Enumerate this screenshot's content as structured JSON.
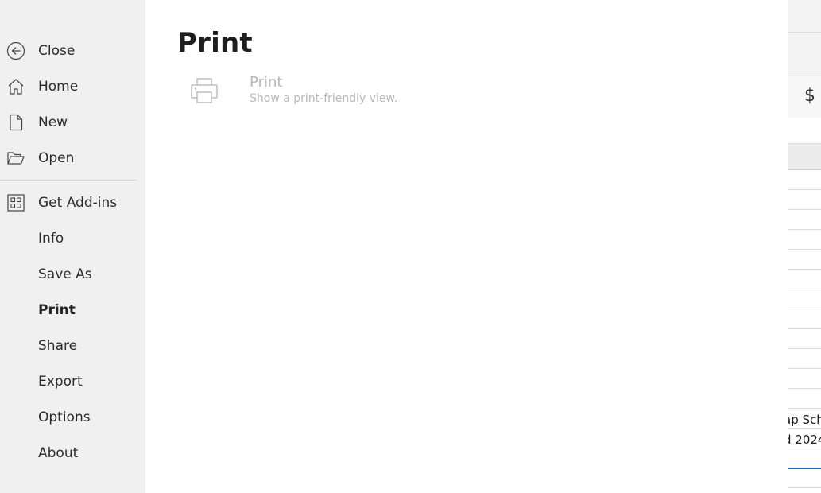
{
  "nav": {
    "items": [
      {
        "label": "Close",
        "icon": "back-arrow-circle-icon",
        "active": false
      },
      {
        "label": "Home",
        "icon": "home-icon",
        "active": false
      },
      {
        "label": "New",
        "icon": "new-document-icon",
        "active": false
      },
      {
        "label": "Open",
        "icon": "folder-open-icon",
        "active": false
      },
      {
        "label": "Get Add-ins",
        "icon": "add-ins-grid-icon",
        "active": false
      },
      {
        "label": "Info",
        "icon": "",
        "active": false
      },
      {
        "label": "Save As",
        "icon": "",
        "active": false
      },
      {
        "label": "Print",
        "icon": "",
        "active": true
      },
      {
        "label": "Share",
        "icon": "",
        "active": false
      },
      {
        "label": "Export",
        "icon": "",
        "active": false
      },
      {
        "label": "Options",
        "icon": "",
        "active": false
      },
      {
        "label": "About",
        "icon": "",
        "active": false
      }
    ]
  },
  "main": {
    "title": "Print",
    "print_option": {
      "title": "Print",
      "description": "Show a print-friendly view.",
      "icon": "printer-icon"
    }
  },
  "background_sheet": {
    "ribbon_symbol": "$",
    "cells": [
      "ap Sch",
      "d 2024"
    ]
  },
  "colors": {
    "nav_bg": "#f0f0f0",
    "content_bg": "#ffffff",
    "disabled_text": "#b8b8b8",
    "accent_blue": "#1a73c7"
  }
}
